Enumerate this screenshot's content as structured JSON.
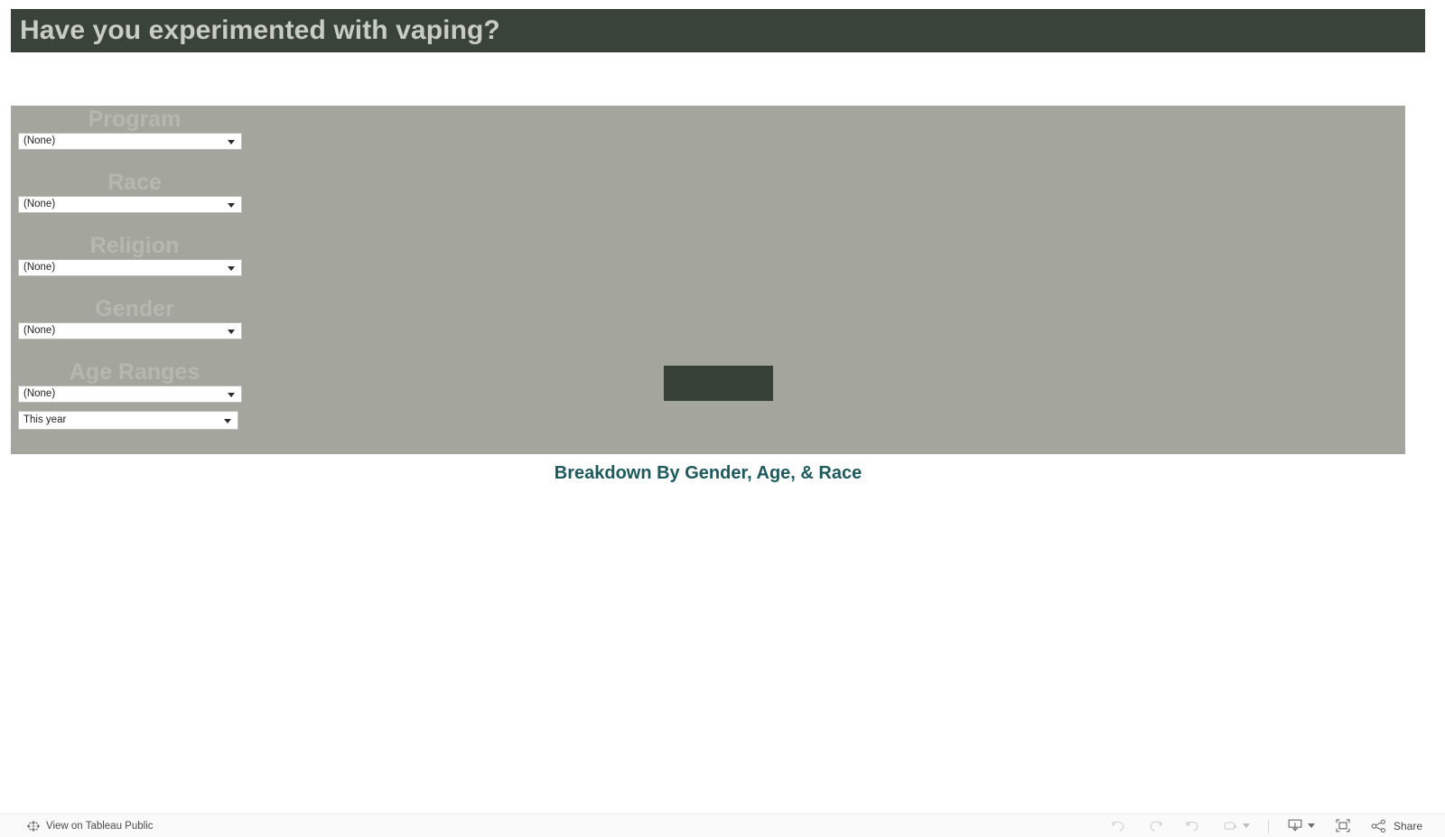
{
  "header": {
    "title": "Have you experimented with vaping?"
  },
  "filters": {
    "items": [
      {
        "label": "Program",
        "value": "(None)",
        "icon": "chevron-down-icon"
      },
      {
        "label": "Race",
        "value": "(None)",
        "icon": "chevron-down-icon"
      },
      {
        "label": "Religion",
        "value": "(None)",
        "icon": "chevron-down-icon"
      },
      {
        "label": "Gender",
        "value": "(None)",
        "icon": "chevron-down-icon"
      },
      {
        "label": "Age Ranges",
        "value": "(None)",
        "icon": "chevron-down-icon"
      }
    ],
    "period": {
      "value": "This year",
      "icon": "chevron-down-icon"
    }
  },
  "main": {
    "sheet_title": "Breakdown By Gender, Age, & Race"
  },
  "toolbar": {
    "tableau_link_label": "View on Tableau Public",
    "tableau_logo_icon": "tableau-logo-icon",
    "undo_icon": "undo-icon",
    "redo_icon": "redo-icon",
    "revert_icon": "revert-icon",
    "refresh_icon": "refresh-icon",
    "refresh_caret_icon": "chevron-down-icon",
    "download_icon": "download-icon",
    "download_caret_icon": "chevron-down-icon",
    "fullscreen_icon": "fullscreen-icon",
    "share_icon": "share-icon",
    "share_label": "Share"
  },
  "colors": {
    "banner_bg": "#394339",
    "banner_text": "#c8ccc4",
    "panel_bg": "#a4a69d",
    "filter_label": "#b6b8ae",
    "placeholder_block": "#384138",
    "sheet_title": "#1d5a5e",
    "toolbar_bg": "#fafafa"
  }
}
